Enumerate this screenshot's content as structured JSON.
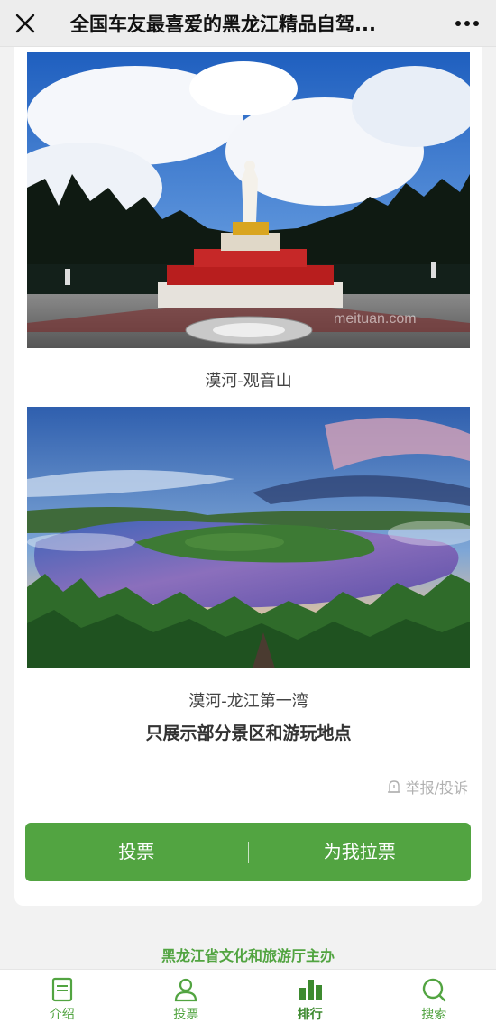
{
  "header": {
    "title": "全国车友最喜爱的黑龙江精品自驾...",
    "close_icon": "close-icon",
    "more_icon": "more-icon"
  },
  "gallery": [
    {
      "caption": "漠河-观音山",
      "watermark": "meituan.com"
    },
    {
      "caption": "漠河-龙江第一湾"
    }
  ],
  "note": "只展示部分景区和游玩地点",
  "report_label": "举报/投诉",
  "actions": {
    "vote_label": "投票",
    "canvass_label": "为我拉票"
  },
  "sponsor": "黑龙江省文化和旅游厅主办",
  "tabs": [
    {
      "label": "介绍",
      "icon": "document-icon"
    },
    {
      "label": "投票",
      "icon": "person-icon"
    },
    {
      "label": "排行",
      "icon": "bar-chart-icon",
      "active": true
    },
    {
      "label": "搜索",
      "icon": "search-icon"
    }
  ],
  "colors": {
    "accent": "#52a441",
    "header_bg": "#ededed",
    "page_bg": "#f2f2f2"
  }
}
